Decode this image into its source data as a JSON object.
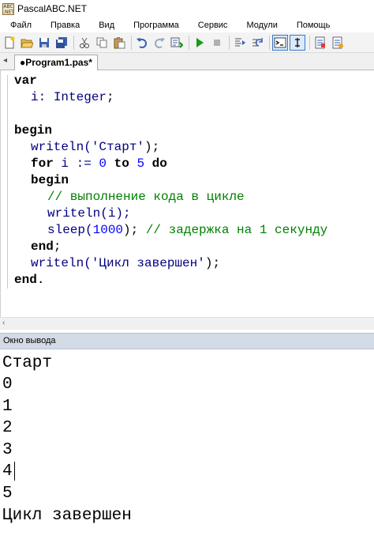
{
  "window": {
    "title": "PascalABC.NET",
    "icon_text": "ABC.NET"
  },
  "menu": [
    "Файл",
    "Правка",
    "Вид",
    "Программа",
    "Сервис",
    "Модули",
    "Помощь"
  ],
  "toolbar": {
    "buttons": [
      "new-file-icon",
      "open-folder-icon",
      "save-icon",
      "save-all-icon",
      "cut-icon",
      "copy-icon",
      "paste-icon",
      "undo-icon",
      "redo-icon",
      "format-code-icon",
      "run-icon",
      "stop-icon",
      "step-into-icon",
      "step-over-icon",
      "output-window-icon",
      "toggle-panel-icon",
      "compile-icon",
      "help-icon"
    ]
  },
  "tab": {
    "label": "●Program1.pas*"
  },
  "code": {
    "l1_kw": "var",
    "l2_id": "i",
    "l2_colon": ": ",
    "l2_type": "Integer",
    "l2_semi": ";",
    "l3_kw": "begin",
    "l4_fn": "writeln(",
    "l4_str": "'Старт'",
    "l4_end": ");",
    "l5_for": "for",
    "l5_var": " i := ",
    "l5_n0": "0",
    "l5_to": "to",
    "l5_n5": "5",
    "l5_do": "do",
    "l6_kw": "begin",
    "l7_cmt": "// выполнение кода в цикле",
    "l8_text": "writeln(i);",
    "l9_fn": "sleep(",
    "l9_num": "1000",
    "l9_end": "); ",
    "l9_cmt": "// задержка на 1 секунду",
    "l10_kw": "end",
    "l10_semi": ";",
    "l11_fn": "writeln(",
    "l11_str": "'Цикл завершен'",
    "l11_end": ");",
    "l12_kw": "end",
    "l12_dot": "."
  },
  "output_panel": {
    "title": "Окно вывода",
    "lines": [
      "Старт",
      "0",
      "1",
      "2",
      "3",
      "4",
      "5",
      "Цикл завершен"
    ]
  }
}
